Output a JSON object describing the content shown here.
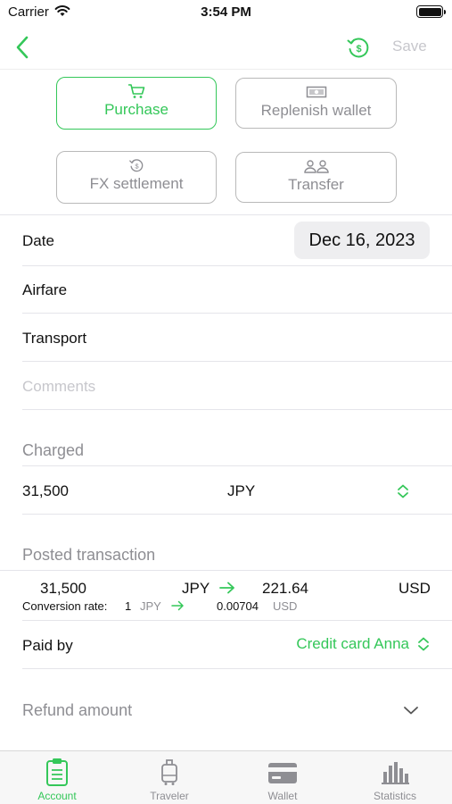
{
  "status": {
    "carrier": "Carrier",
    "time": "3:54 PM"
  },
  "nav": {
    "save_label": "Save"
  },
  "types": {
    "purchase": "Purchase",
    "replenish": "Replenish wallet",
    "fx": "FX settlement",
    "transfer": "Transfer"
  },
  "form": {
    "date_label": "Date",
    "date_value": "Dec 16, 2023",
    "category": "Airfare",
    "subcategory": "Transport",
    "comments_placeholder": "Comments"
  },
  "charged": {
    "title": "Charged",
    "amount": "31,500",
    "currency": "JPY"
  },
  "posted": {
    "title": "Posted transaction",
    "amount": "31,500",
    "from_currency": "JPY",
    "converted": "221.64",
    "to_currency": "USD",
    "rate_label": "Conversion rate:",
    "rate_from_qty": "1",
    "rate_from_ccy": "JPY",
    "rate_value": "0.00704",
    "rate_to_ccy": "USD"
  },
  "paid_by": {
    "label": "Paid by",
    "value": "Credit card Anna"
  },
  "refund": {
    "label": "Refund amount"
  },
  "tabs": [
    {
      "label": "Account",
      "icon": "clipboard-icon"
    },
    {
      "label": "Traveler",
      "icon": "suitcase-icon"
    },
    {
      "label": "Wallet",
      "icon": "wallet-icon"
    },
    {
      "label": "Statistics",
      "icon": "bar-chart-icon"
    }
  ],
  "colors": {
    "accent": "#34c759",
    "muted": "#8e8e93",
    "placeholder": "#c7c7cc"
  }
}
